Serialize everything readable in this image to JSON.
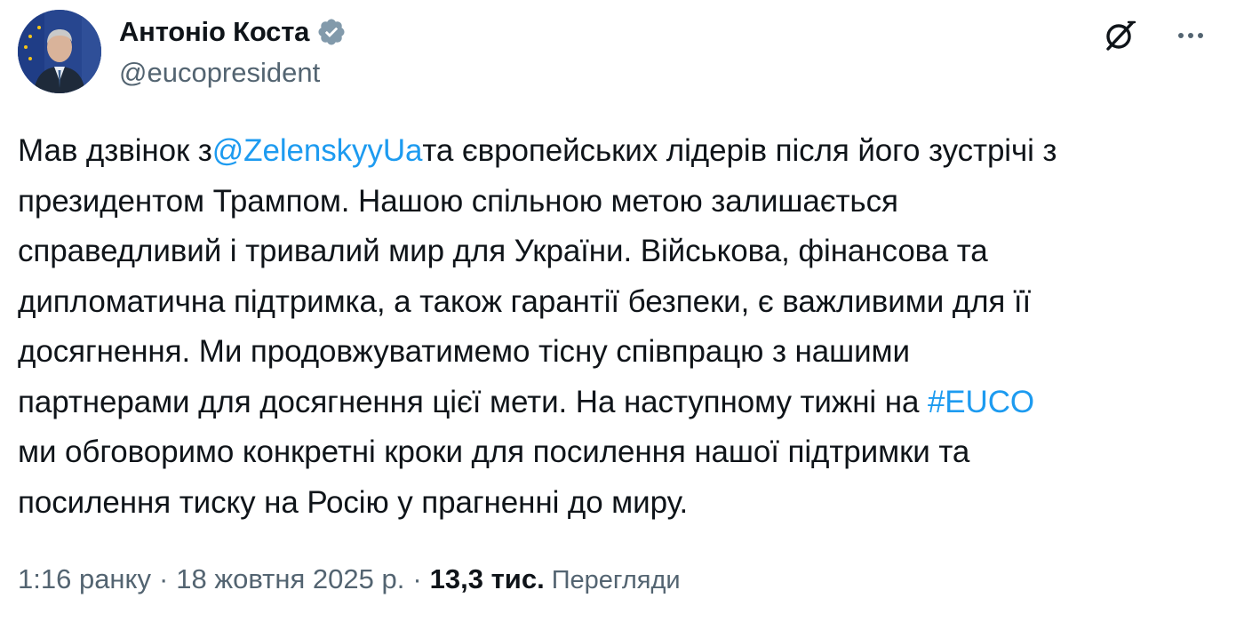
{
  "author": {
    "display_name": "Антоніо Коста",
    "handle": "@eucopresident",
    "verified": true,
    "verified_color": "#829aab"
  },
  "actions": {
    "grok_icon": "grok-icon",
    "more_icon": "more-icon"
  },
  "tweet": {
    "lines": [
      {
        "segments": [
          {
            "text": "Мав дзвінок з",
            "type": "text"
          },
          {
            "text": "@ZelenskyyUa",
            "type": "mention"
          },
          {
            "text": "та європейських лідерів після його зустрічі з",
            "type": "text"
          }
        ]
      },
      {
        "segments": [
          {
            "text": "президентом Трампом. Нашою спільною метою залишається",
            "type": "text"
          }
        ]
      },
      {
        "segments": [
          {
            "text": "справедливий і тривалий мир для України. Військова, фінансова та",
            "type": "text"
          }
        ]
      },
      {
        "segments": [
          {
            "text": "дипломатична підтримка, а також гарантії безпеки, є важливими для її",
            "type": "text"
          }
        ]
      },
      {
        "segments": [
          {
            "text": "досягнення. Ми продовжуватимемо тісну співпрацю з нашими",
            "type": "text"
          }
        ]
      },
      {
        "segments": [
          {
            "text": "партнерами для досягнення цієї мети. На наступному тижні на ",
            "type": "text"
          },
          {
            "text": "#EUCO",
            "type": "hashtag"
          }
        ]
      },
      {
        "segments": [
          {
            "text": "ми обговоримо конкретні кроки для посилення нашої підтримки та",
            "type": "text"
          }
        ]
      },
      {
        "segments": [
          {
            "text": "посилення тиску на Росію у прагненні до миру.",
            "type": "text"
          }
        ]
      }
    ]
  },
  "meta": {
    "time": "1:16 ранку",
    "separator": "·",
    "date": "18 жовтня 2025 р.",
    "views_count": "13,3 тис.",
    "views_label": "Перегляди"
  },
  "colors": {
    "link": "#1d9bf0",
    "text": "#0f1419",
    "secondary": "#536471"
  }
}
